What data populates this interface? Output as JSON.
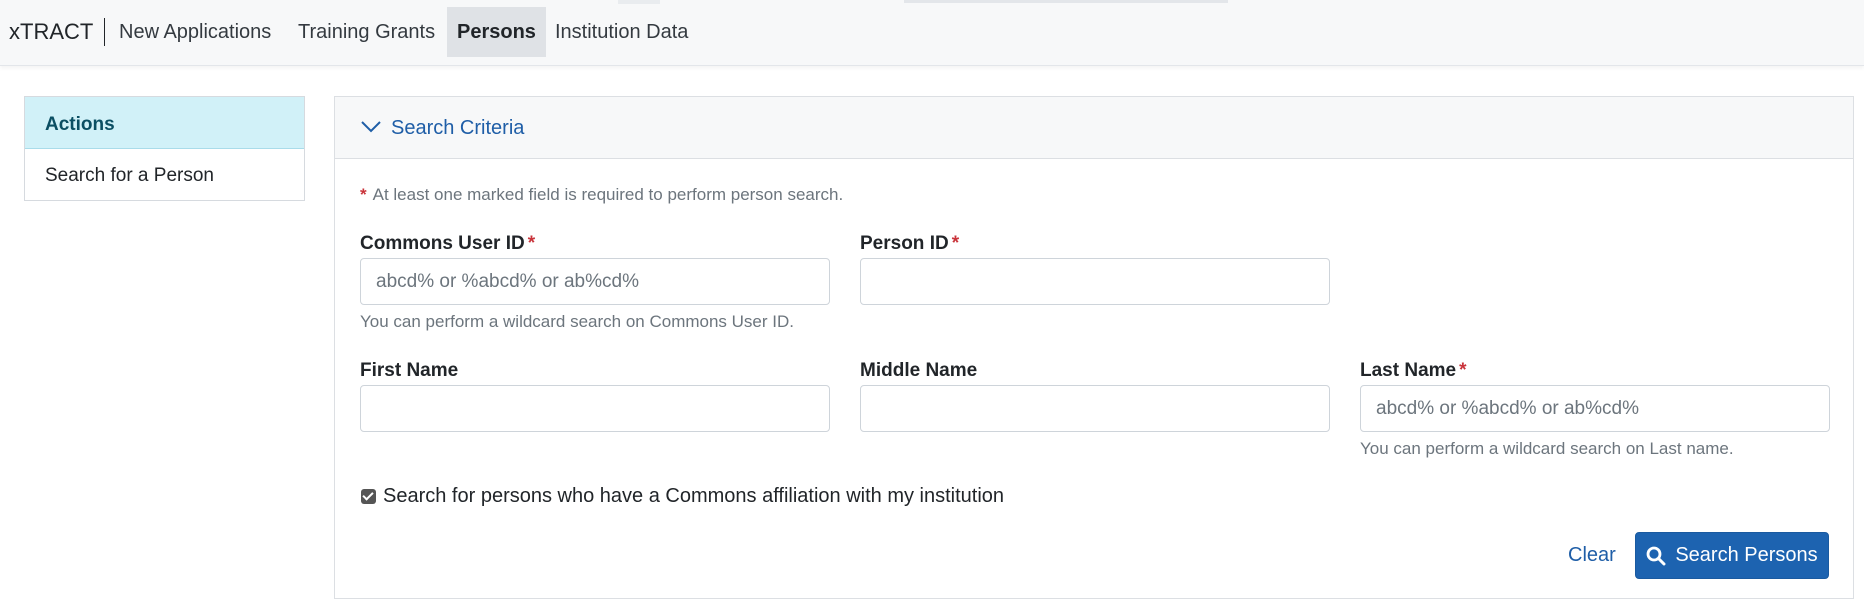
{
  "nav": {
    "brand": "xTRACT",
    "items": [
      {
        "label": "New Applications",
        "active": false
      },
      {
        "label": "Training Grants",
        "active": false
      },
      {
        "label": "Persons",
        "active": true
      },
      {
        "label": "Institution Data",
        "active": false
      }
    ]
  },
  "sidebar": {
    "header": "Actions",
    "items": [
      {
        "label": "Search for a Person"
      }
    ]
  },
  "panel": {
    "title": "Search Criteria",
    "required_note": "At least one marked field is required to perform person search.",
    "required_marker": "*",
    "fields": {
      "commons_user_id": {
        "label": "Commons User ID",
        "placeholder": "abcd% or %abcd% or ab%cd%",
        "help": "You can perform a wildcard search on Commons User ID."
      },
      "person_id": {
        "label": "Person ID",
        "placeholder": ""
      },
      "first_name": {
        "label": "First Name",
        "placeholder": ""
      },
      "middle_name": {
        "label": "Middle Name",
        "placeholder": ""
      },
      "last_name": {
        "label": "Last Name",
        "placeholder": "abcd% or %abcd% or ab%cd%",
        "help": "You can perform a wildcard search on Last name."
      }
    },
    "affiliation_checkbox": {
      "label": "Search for persons who have a Commons affiliation with my institution",
      "checked": true
    },
    "clear_label": "Clear",
    "search_label": "Search Persons"
  },
  "colors": {
    "primary": "#1d63b0",
    "link": "#1f5ea7",
    "required": "#c9333a",
    "sidebar_header_bg": "#d1f1f8"
  },
  "icons": [
    "chevron-down-icon",
    "search-icon",
    "checkbox-checked-icon"
  ]
}
